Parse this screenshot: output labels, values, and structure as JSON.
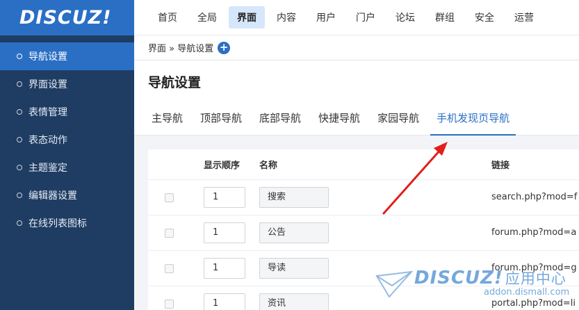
{
  "logo": {
    "text": "DISCUZ!"
  },
  "sidebar": {
    "items": [
      {
        "label": "导航设置",
        "active": true
      },
      {
        "label": "界面设置"
      },
      {
        "label": "表情管理"
      },
      {
        "label": "表态动作"
      },
      {
        "label": "主题鉴定"
      },
      {
        "label": "编辑器设置"
      },
      {
        "label": "在线列表图标"
      }
    ]
  },
  "topnav": {
    "items": [
      {
        "label": "首页"
      },
      {
        "label": "全局"
      },
      {
        "label": "界面",
        "active": true
      },
      {
        "label": "内容"
      },
      {
        "label": "用户"
      },
      {
        "label": "门户"
      },
      {
        "label": "论坛"
      },
      {
        "label": "群组"
      },
      {
        "label": "安全"
      },
      {
        "label": "运营"
      }
    ]
  },
  "breadcrumb": {
    "text": "界面 » 导航设置",
    "plus": "+"
  },
  "page": {
    "title": "导航设置"
  },
  "tabs": [
    {
      "label": "主导航"
    },
    {
      "label": "顶部导航"
    },
    {
      "label": "底部导航"
    },
    {
      "label": "快捷导航"
    },
    {
      "label": "家园导航"
    },
    {
      "label": "手机发现页导航",
      "active": true
    }
  ],
  "table": {
    "headers": {
      "order": "显示顺序",
      "name": "名称",
      "link": "链接"
    },
    "rows": [
      {
        "order": "1",
        "name": "搜索",
        "link": "search.php?mod=f"
      },
      {
        "order": "1",
        "name": "公告",
        "link": "forum.php?mod=a"
      },
      {
        "order": "1",
        "name": "导读",
        "link": "forum.php?mod=g"
      },
      {
        "order": "1",
        "name": "资讯",
        "link": "portal.php?mod=li"
      }
    ]
  },
  "watermark": {
    "logo": "DISCUZ!",
    "cn": "应用中心",
    "url": "addon.dismall.com"
  },
  "colors": {
    "brand": "#2a6fc4",
    "sidebar": "#1f3d63",
    "arrow": "#e0201c"
  },
  "icons": {
    "annotation": "red-arrow-icon",
    "watermark": "paper-plane-icon"
  }
}
